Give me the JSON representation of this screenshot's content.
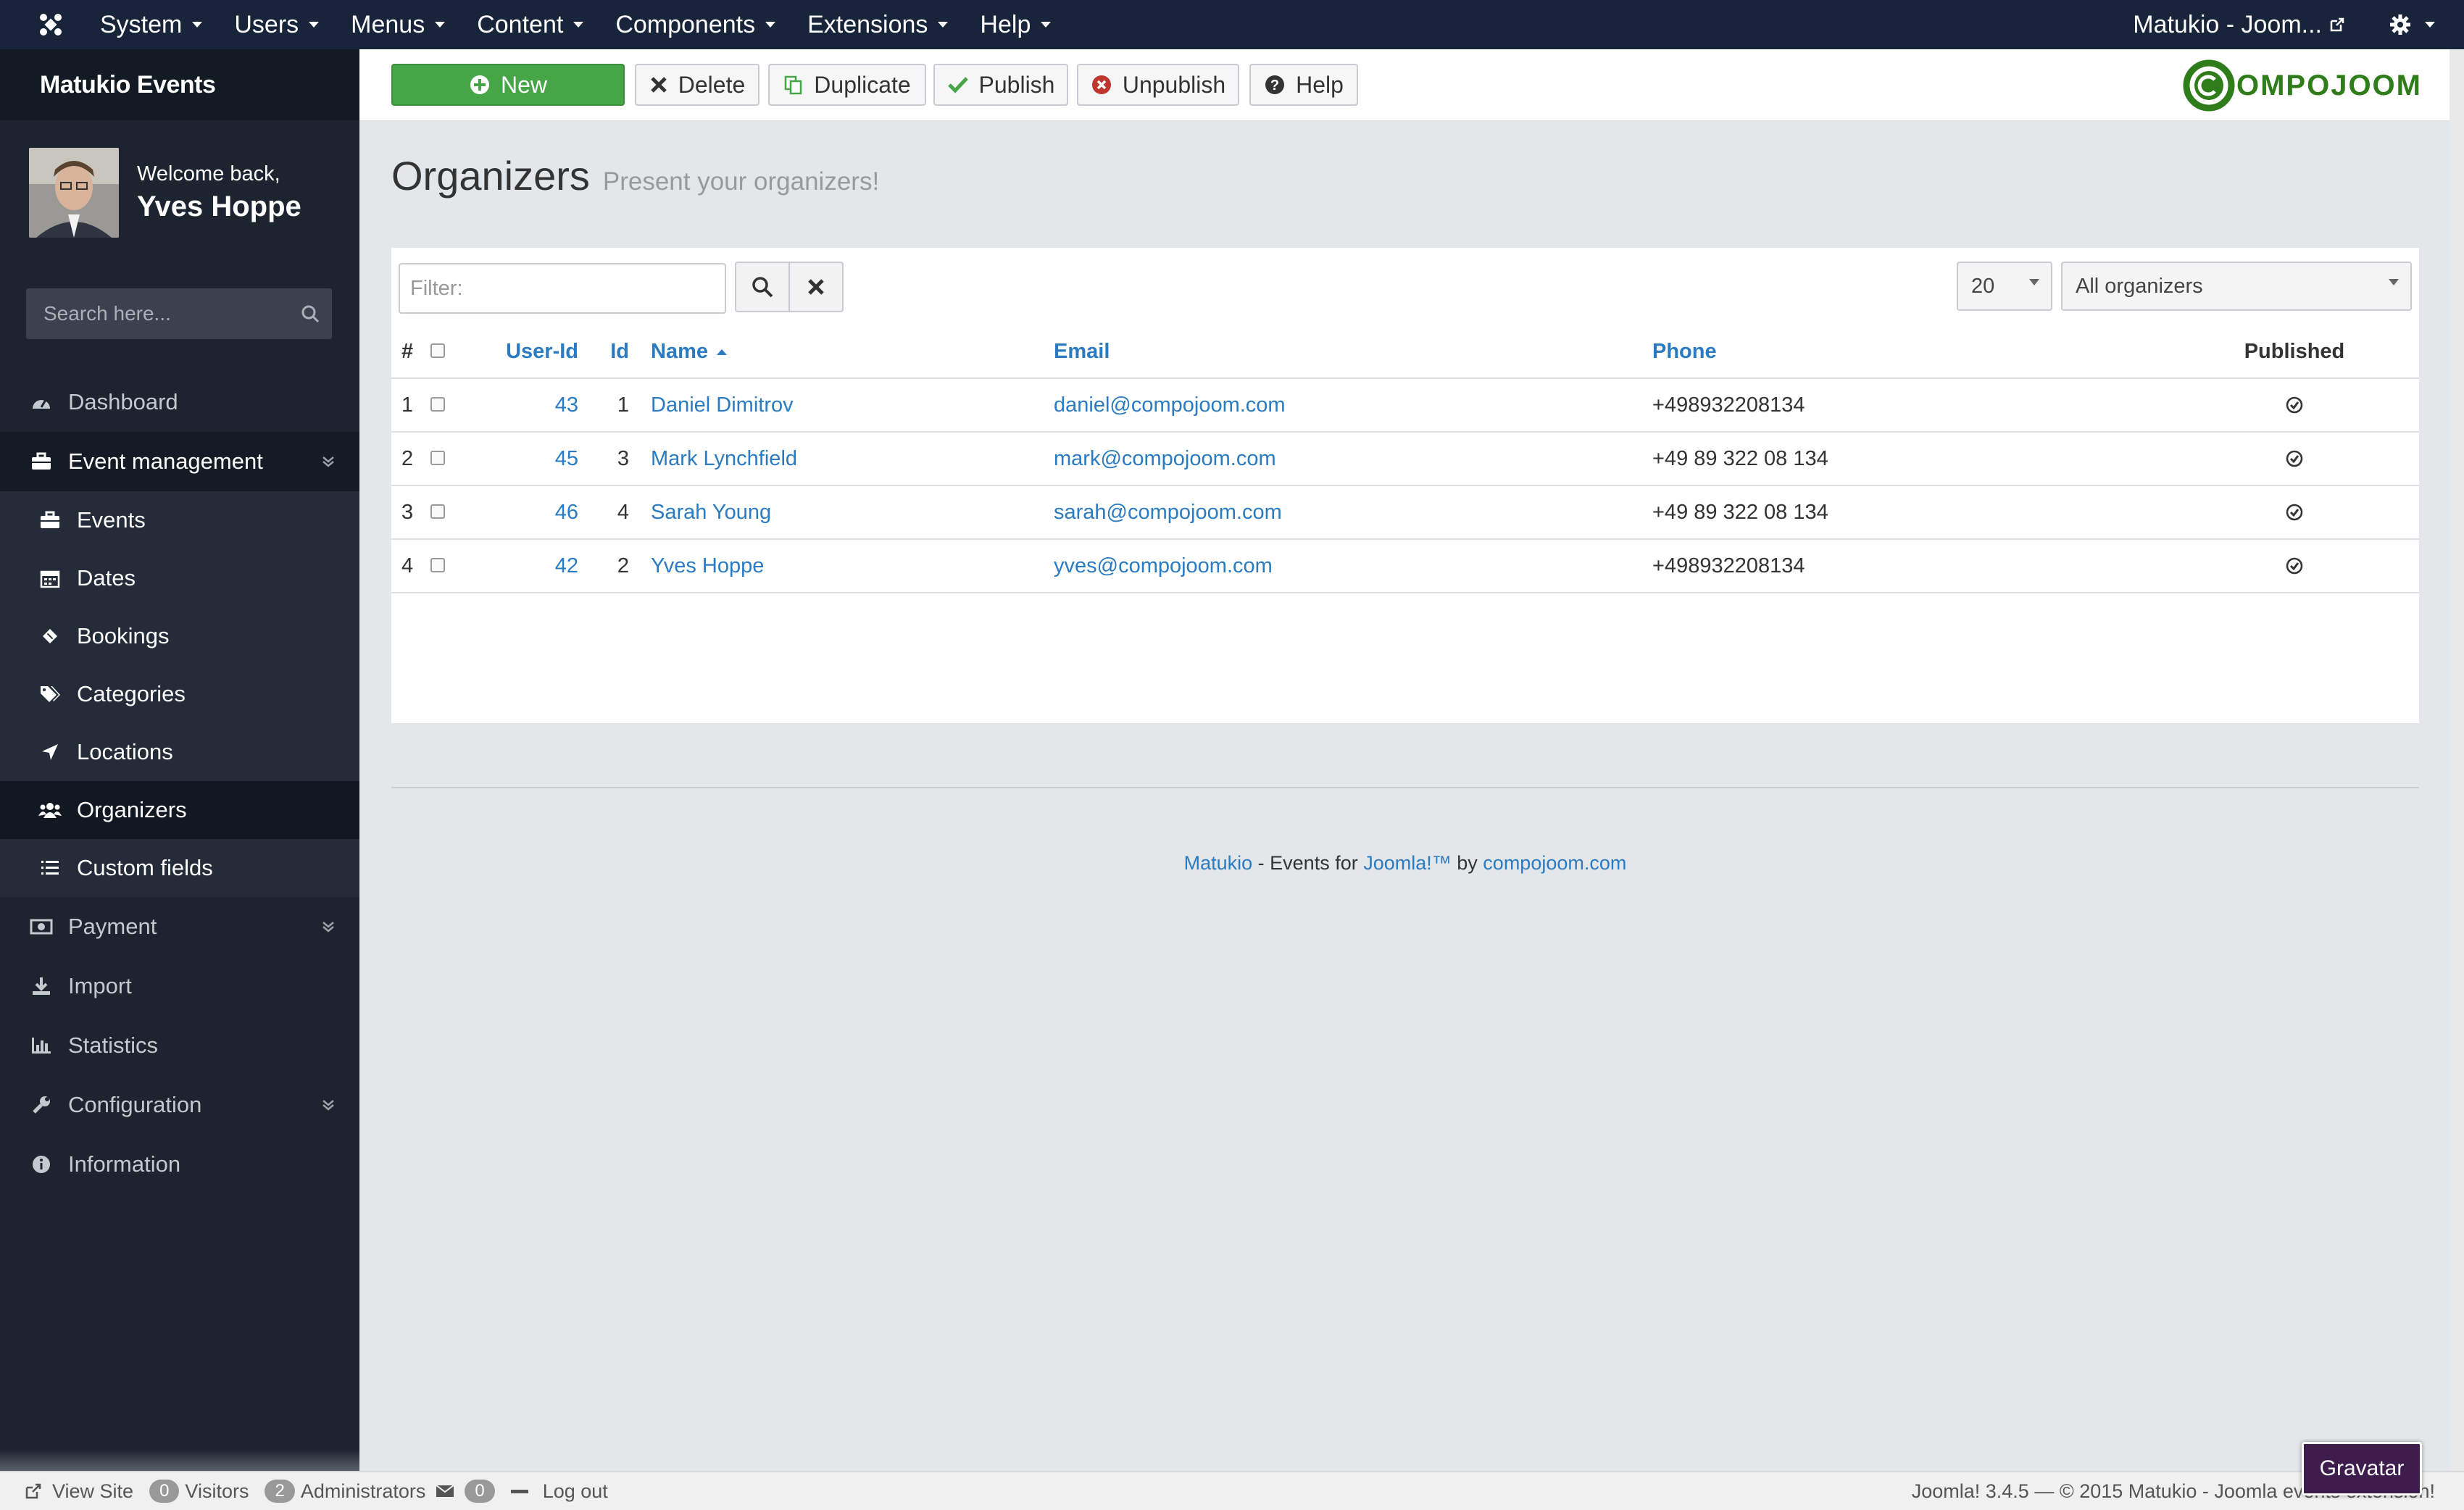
{
  "topbar": {
    "menus": [
      "System",
      "Users",
      "Menus",
      "Content",
      "Components",
      "Extensions",
      "Help"
    ],
    "site_name": "Matukio - Joom..."
  },
  "sidebar": {
    "brand": "Matukio Events",
    "welcome": "Welcome back,",
    "username": "Yves Hoppe",
    "search_placeholder": "Search here...",
    "items": {
      "dashboard": "Dashboard",
      "event_management": "Event management",
      "events": "Events",
      "dates": "Dates",
      "bookings": "Bookings",
      "categories": "Categories",
      "locations": "Locations",
      "organizers": "Organizers",
      "custom_fields": "Custom fields",
      "payment": "Payment",
      "import": "Import",
      "statistics": "Statistics",
      "configuration": "Configuration",
      "information": "Information"
    }
  },
  "toolbar": {
    "new": "New",
    "delete": "Delete",
    "duplicate": "Duplicate",
    "publish": "Publish",
    "unpublish": "Unpublish",
    "help": "Help",
    "logo_text": "OMPOJOOM"
  },
  "page": {
    "title": "Organizers",
    "subtitle": "Present your organizers!"
  },
  "filters": {
    "filter_placeholder": "Filter:",
    "limit": "20",
    "scope": "All organizers"
  },
  "table": {
    "headers": {
      "num": "#",
      "user_id": "User-Id",
      "id": "Id",
      "name": "Name",
      "email": "Email",
      "phone": "Phone",
      "published": "Published"
    },
    "rows": [
      {
        "num": "1",
        "user_id": "43",
        "id": "1",
        "name": "Daniel Dimitrov",
        "email": "daniel@compojoom.com",
        "phone": "+498932208134"
      },
      {
        "num": "2",
        "user_id": "45",
        "id": "3",
        "name": "Mark Lynchfield",
        "email": "mark@compojoom.com",
        "phone": "+49 89 322 08 134"
      },
      {
        "num": "3",
        "user_id": "46",
        "id": "4",
        "name": "Sarah Young",
        "email": "sarah@compojoom.com",
        "phone": "+49 89 322 08 134"
      },
      {
        "num": "4",
        "user_id": "42",
        "id": "2",
        "name": "Yves Hoppe",
        "email": "yves@compojoom.com",
        "phone": "+498932208134"
      }
    ]
  },
  "footer": {
    "matukio": "Matukio",
    "events_for": " - Events for ",
    "joomla": "Joomla!™",
    "by": " by ",
    "compojoom": "compojoom.com"
  },
  "statusbar": {
    "view_site": "View Site",
    "visitors_count": "0",
    "visitors": "Visitors",
    "admins_count": "2",
    "admins": "Administrators",
    "messages_count": "0",
    "logout": "Log out",
    "version": "Joomla! 3.4.5  —  © 2015 Matukio - Joomla events extension!"
  },
  "gravatar": "Gravatar",
  "colors": {
    "topbar": "#17243a",
    "sidebar": "#1c2430",
    "link": "#2a7bc1",
    "new_button": "#46a546",
    "logo_green": "#2e7d1a"
  }
}
